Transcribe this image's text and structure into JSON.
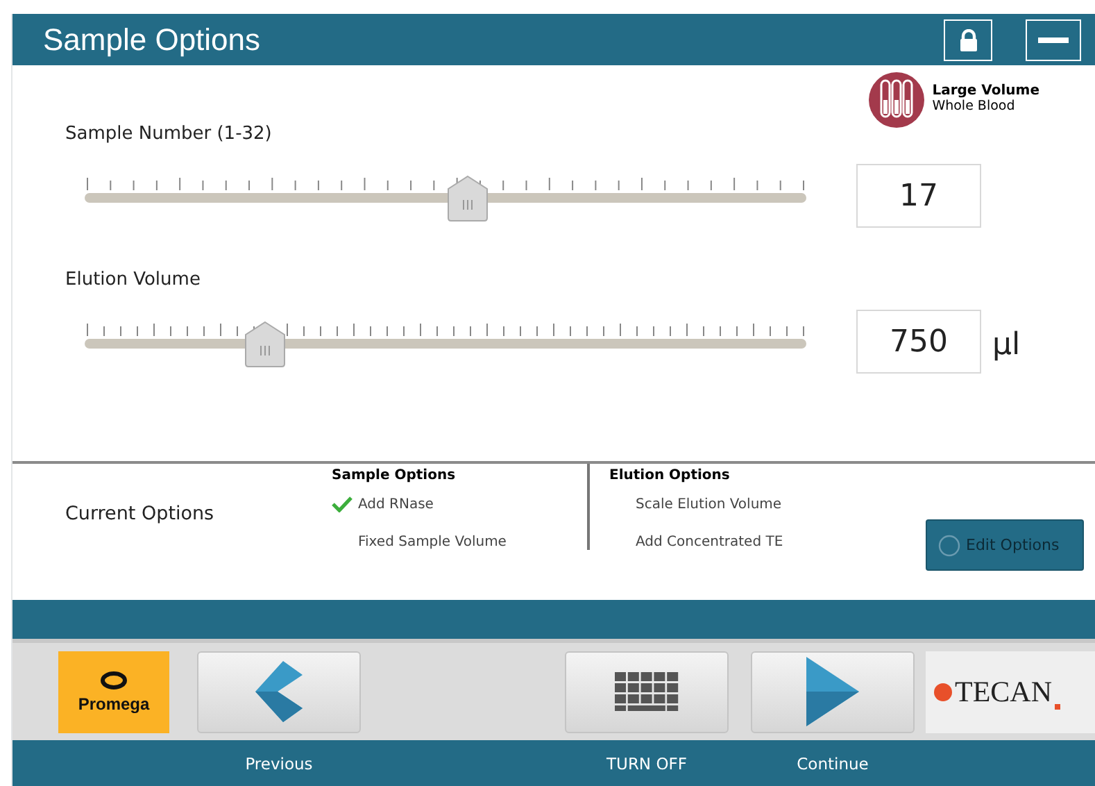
{
  "window": {
    "title": "Sample Options"
  },
  "header_buttons": [
    {
      "kind": "lock"
    },
    {
      "kind": "minimize"
    }
  ],
  "sample_type": {
    "title": "Large Volume",
    "subtitle": "Whole Blood"
  },
  "sliders": [
    {
      "label": "Sample Number (1-32)",
      "level": 0.53,
      "value": "17"
    },
    {
      "label": "Elution Volume",
      "level": 0.25,
      "value": "750",
      "unit": "µl"
    }
  ],
  "current_options": {
    "label": "Current Options",
    "groups": [
      {
        "title": "Sample Options",
        "items": [
          {
            "text": "Add RNase",
            "checked": true
          },
          {
            "text": "Fixed Sample Volume",
            "checked": false
          }
        ]
      },
      {
        "title": "Elution Options",
        "items": [
          {
            "text": "Scale Elution Volume",
            "checked": false
          },
          {
            "text": "Add Concentrated TE",
            "checked": false
          }
        ]
      }
    ],
    "button": "Edit Options"
  },
  "footer": {
    "logo": "Promega",
    "brand": "TECAN",
    "buttons": [
      {
        "kind": "previous",
        "label": "Previous"
      },
      {
        "kind": "keyboard",
        "label": "TURN OFF"
      },
      {
        "kind": "continue",
        "label": "Continue"
      }
    ]
  }
}
